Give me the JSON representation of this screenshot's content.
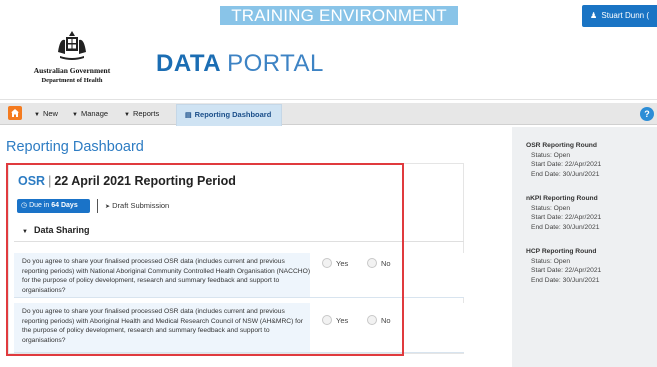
{
  "header": {
    "environment_banner": "TRAINING ENVIRONMENT",
    "user_name": "Stuart Dunn (",
    "gov_name": "Australian Government",
    "gov_department": "Department of Health",
    "portal_title_bold": "DATA",
    "portal_title_light": "PORTAL"
  },
  "navbar": {
    "items": [
      {
        "label": "New"
      },
      {
        "label": "Manage"
      },
      {
        "label": "Reports"
      }
    ],
    "active_label": "Reporting Dashboard",
    "help_glyph": "?"
  },
  "main": {
    "page_title": "Reporting Dashboard",
    "card": {
      "title_prefix": "OSR",
      "title_separator": "|",
      "title_rest": "22 April 2021 Reporting Period",
      "due_prefix": "Due in",
      "due_days": "64 Days",
      "status": "Draft Submission",
      "section_title": "Data Sharing",
      "questions": [
        {
          "text": "Do you agree to share your finalised processed OSR data (includes current and previous reporting periods) with National Aboriginal Community Controlled Health Organisation (NACCHO) for the purpose of policy development, research and summary feedback and support to organisations?",
          "options": [
            "Yes",
            "No"
          ]
        },
        {
          "text": "Do you agree to share your finalised processed OSR data (includes current and previous reporting periods) with Aboriginal Health and Medical Research Council of NSW (AH&MRC) for the purpose of policy development, research and summary feedback and support to organisations?",
          "options": [
            "Yes",
            "No"
          ]
        }
      ]
    }
  },
  "sidebar": {
    "rounds": [
      {
        "name": "OSR Reporting Round",
        "status": "Status: Open",
        "start": "Start Date: 22/Apr/2021",
        "end": "End Date: 30/Jun/2021"
      },
      {
        "name": "nKPI Reporting Round",
        "status": "Status: Open",
        "start": "Start Date: 22/Apr/2021",
        "end": "End Date: 30/Jun/2021"
      },
      {
        "name": "HCP Reporting Round",
        "status": "Status: Open",
        "start": "Start Date: 22/Apr/2021",
        "end": "End Date: 30/Jun/2021"
      }
    ]
  },
  "colors": {
    "brand_blue": "#1a73c8",
    "title_blue": "#2d7cc3",
    "home_orange": "#f47b20",
    "highlight_red": "#e03a3e",
    "banner_blue": "#89c4e8"
  },
  "icons": {
    "home": "home-icon",
    "user": "user-icon",
    "dashboard": "dashboard-icon",
    "clock": "clock-icon",
    "draft": "arrow-circle-icon",
    "help": "help-icon"
  }
}
